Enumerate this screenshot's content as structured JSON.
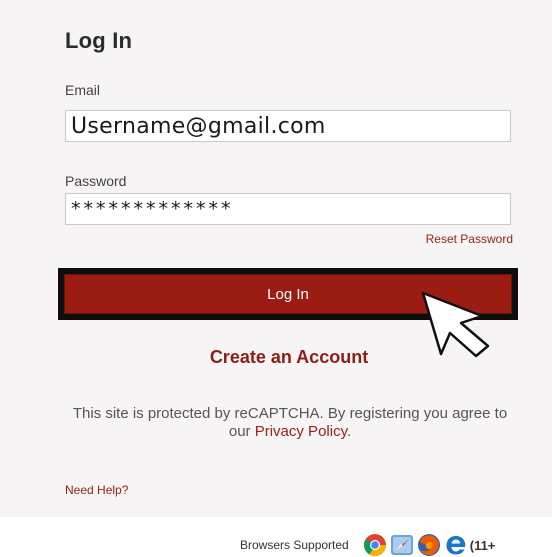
{
  "login": {
    "title": "Log In",
    "email_label": "Email",
    "email_value": "Username@gmail.com",
    "password_label": "Password",
    "password_value": "*************",
    "reset_link": "Reset Password",
    "submit_label": "Log In",
    "create_account": "Create an Account",
    "notice_text": "This site is protected by reCAPTCHA. By registering you agree to our",
    "notice_link": "Privacy Policy",
    "notice_end": ".",
    "help_link": "Need Help?"
  },
  "footer": {
    "label": "Browsers Supported",
    "browsers": [
      "chrome-icon",
      "safari-icon",
      "firefox-icon",
      "ie-icon"
    ],
    "ie_version": "(11+"
  },
  "colors": {
    "accent": "#9b1c12",
    "panel": "#f6f4f4",
    "link": "#9b2217"
  }
}
